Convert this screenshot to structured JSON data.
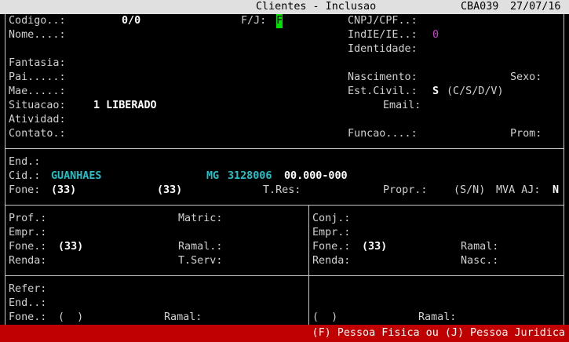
{
  "titlebar": {
    "title": "Clientes - Inclusao",
    "program": "CBA039",
    "date": "27/07/16"
  },
  "top": {
    "codigo_label": "Codigo..:",
    "codigo_value": "0/0",
    "fj_label": "F/J:",
    "fj_value": "F",
    "cnpj_label": "CNPJ/CPF..:",
    "nome_label": "Nome....:",
    "indie_label": "IndIE/IE..:",
    "indie_value": "0",
    "identidade_label": "Identidade:",
    "fantasia_label": "Fantasia:",
    "pai_label": "Pai.....:",
    "nascimento_label": "Nascimento:",
    "sexo_label": "Sexo:",
    "mae_label": "Mae.....:",
    "estcivil_label": "Est.Civil.:",
    "estcivil_value": "S",
    "estcivil_options": "(C/S/D/V)",
    "email_label": "Email:",
    "situacao_label": "Situacao:",
    "situacao_value": "1 LIBERADO",
    "atividad_label": "Atividad:",
    "contato_label": "Contato.:",
    "funcao_label": "Funcao....:",
    "prom_label": "Prom:"
  },
  "address": {
    "end_label": "End.:",
    "cid_label": "Cid.:",
    "cid_value": "GUANHAES",
    "uf_value": "MG",
    "ibge_value": "3128006",
    "cep_value": "00.000-000",
    "fone_label": "Fone:",
    "fone_value": "(33)",
    "fone2_value": "(33)",
    "tres_label": "T.Res:",
    "propr_label": "Propr.:",
    "sn_label": "(S/N)",
    "mva_label": "MVA AJ:",
    "mva_value": "N"
  },
  "work": {
    "prof_label": "Prof.:",
    "matric_label": "Matric:",
    "empr_label": "Empr.:",
    "fone_label": "Fone.:",
    "fone_value": "(33)",
    "ramal_label": "Ramal.:",
    "renda_label": "Renda:",
    "tserv_label": "T.Serv:"
  },
  "spouse": {
    "conj_label": "Conj.:",
    "empr_label": "Empr.:",
    "fone_label": "Fone.:",
    "fone_value": "(33)",
    "ramal_label": "Ramal:",
    "renda_label": "Renda:",
    "nasc_label": "Nasc.:"
  },
  "reference": {
    "refer_label": "Refer:",
    "end_label": "End..:",
    "fone_label": "Fone.:",
    "fone_value": "(  )",
    "ramal_label": "Ramal:",
    "fone2_value": "(  )",
    "ramal2_label": "Ramal:"
  },
  "statusbar": {
    "message": "(F) Pessoa Fisica ou (J) Pessoa Juridica"
  }
}
